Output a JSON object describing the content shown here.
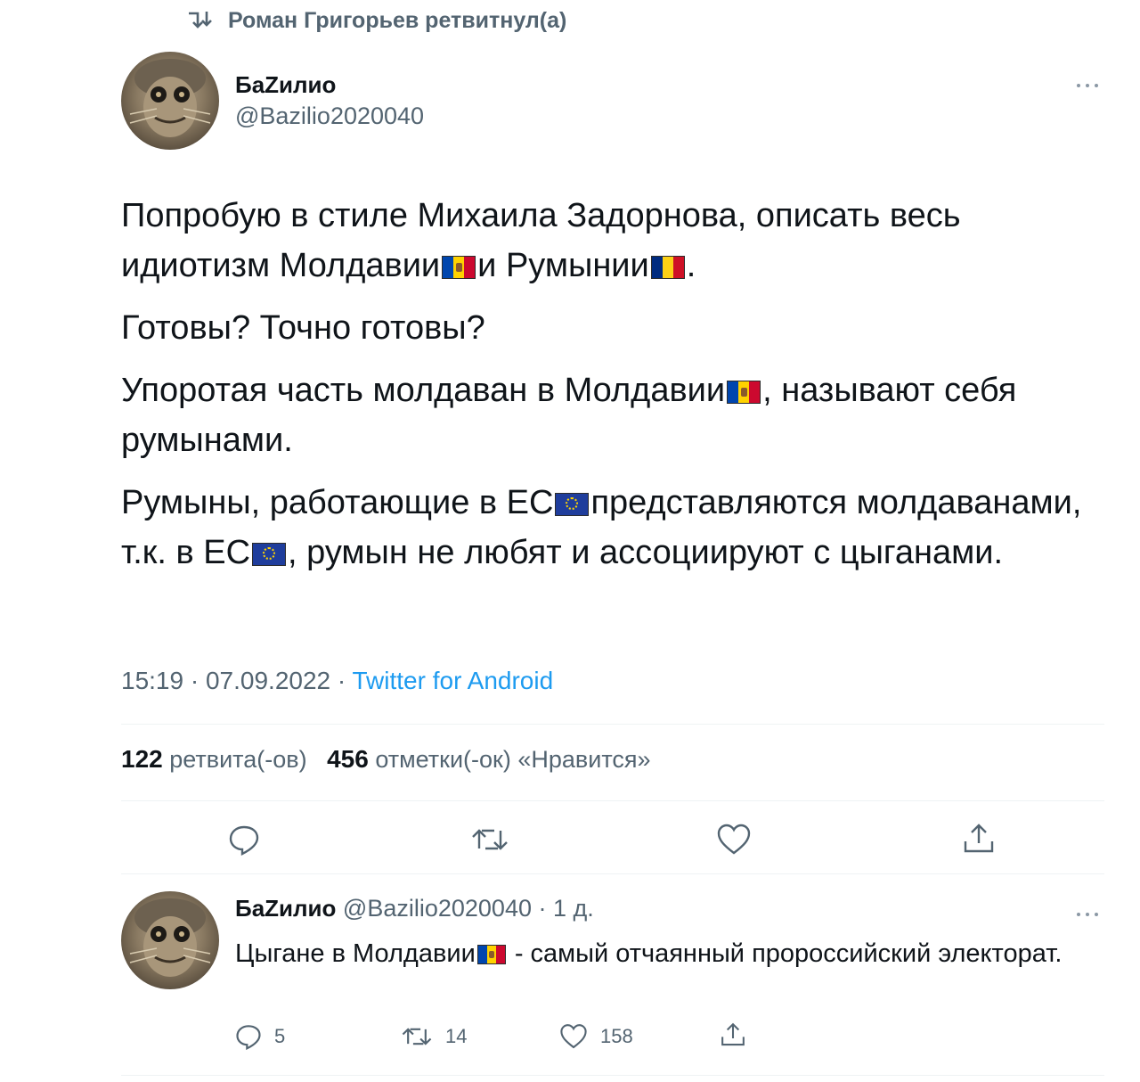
{
  "retweet_header": {
    "icon": "retweet-icon",
    "text": "Роман Григорьев ретвитнул(а)"
  },
  "tweet": {
    "author_name": "БаZилио",
    "author_handle": "@Bazilio2020040",
    "paragraphs": [
      [
        "Попробую в стиле Михаила Задорнова, описать весь идиотизм Молдавии",
        "flag:md",
        "и Румынии",
        "flag:ro",
        "."
      ],
      [
        "Готовы? Точно готовы?"
      ],
      [
        "Упоротая часть молдаван в Молдавии",
        "flag:md",
        ", называют себя румынами."
      ],
      [
        "Румыны, работающие в ЕС",
        "flag:eu",
        "представляются молдаванами, т.к. в ЕС",
        "flag:eu",
        ", румын не любят и ассоциируют с цыганами."
      ]
    ],
    "time": "15:19",
    "date": "07.09.2022",
    "separator": "·",
    "source": "Twitter for Android",
    "retweets_count": "122",
    "retweets_label": "ретвита(-ов)",
    "likes_count": "456",
    "likes_label": "отметки(-ок) «Нравится»"
  },
  "reply": {
    "author_name": "БаZилио",
    "author_handle": "@Bazilio2020040",
    "separator": "·",
    "age": "1 д.",
    "text_parts": [
      "Цыгане в Молдавии",
      "flag:md",
      " - самый отчаянный пророссийский электорат."
    ],
    "replies": "5",
    "retweets": "14",
    "likes": "158"
  },
  "colors": {
    "text": "#0f1419",
    "secondary": "#536471",
    "link": "#1d9bf0",
    "divider": "#eff3f4"
  }
}
